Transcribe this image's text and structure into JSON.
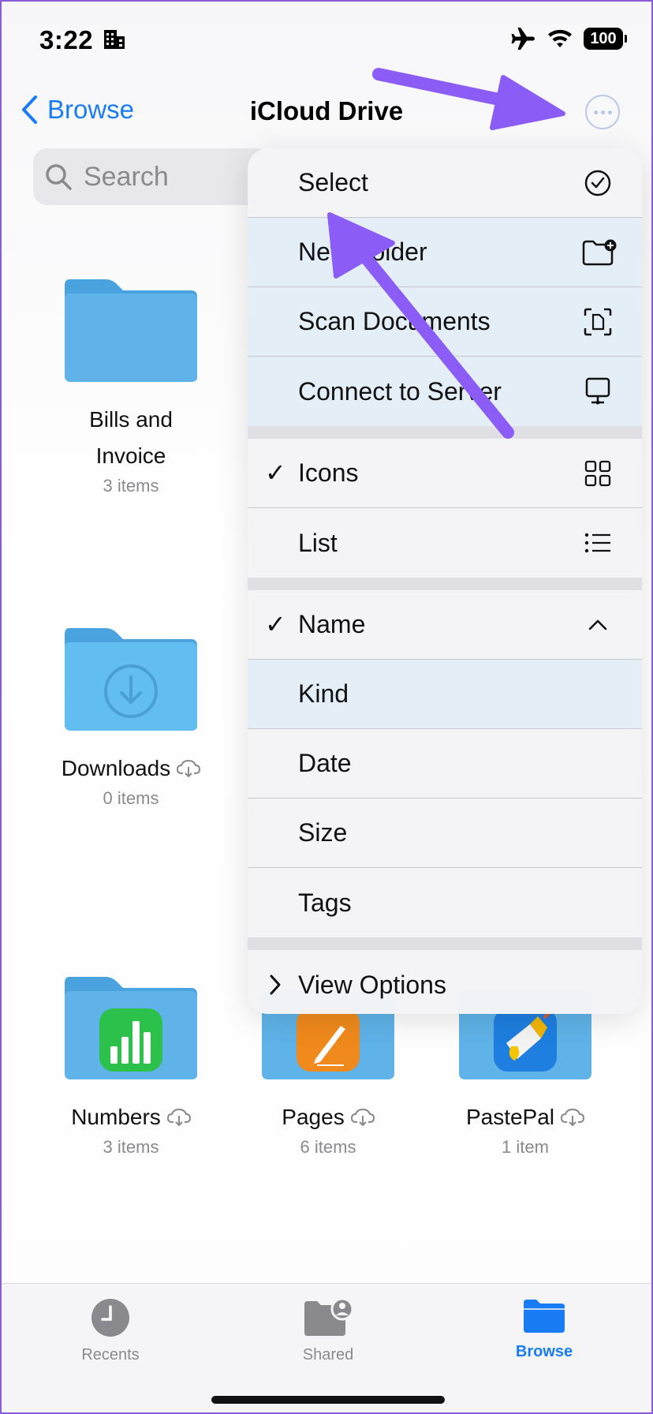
{
  "status": {
    "time": "3:22",
    "battery": "100"
  },
  "nav": {
    "back_label": "Browse",
    "title": "iCloud Drive"
  },
  "search": {
    "placeholder": "Search"
  },
  "folders": [
    {
      "label_line1": "Bills and",
      "label_line2": "Invoice",
      "count": "3 items"
    },
    {
      "label": "Downloads",
      "count": "0 items"
    },
    {
      "label": "Numbers",
      "count": "3 items"
    },
    {
      "label": "Pages",
      "count": "6 items"
    },
    {
      "label": "PastePal",
      "count": "1 item"
    }
  ],
  "menu": {
    "actions": [
      "Select",
      "New Folder",
      "Scan Documents",
      "Connect to Server"
    ],
    "views": [
      "Icons",
      "List"
    ],
    "sorts": [
      "Name",
      "Kind",
      "Date",
      "Size",
      "Tags"
    ],
    "view_options": "View Options",
    "check": "✓"
  },
  "tabs": [
    "Recents",
    "Shared",
    "Browse"
  ],
  "colors": {
    "accent": "#1a7cf5",
    "folder": "#5aaee6",
    "arrow": "#8b5cf6"
  }
}
